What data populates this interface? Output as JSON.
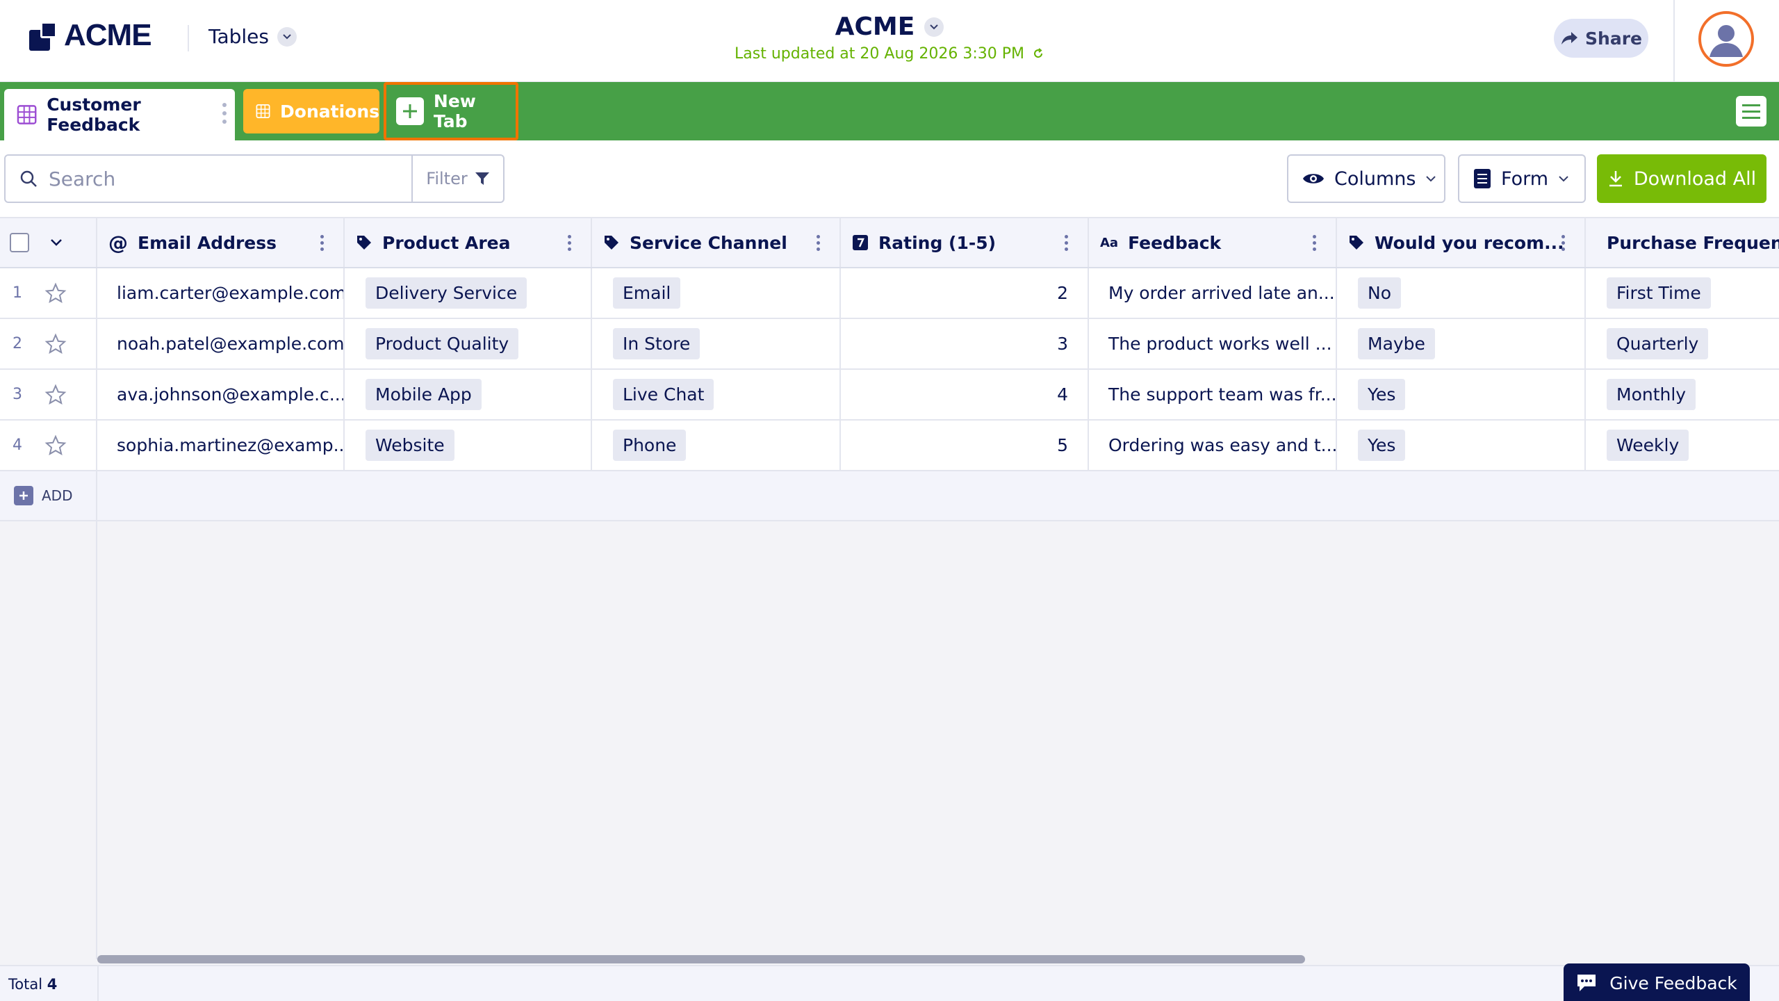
{
  "header": {
    "logo_text": "ACME",
    "tables_label": "Tables",
    "app_title": "ACME",
    "last_updated": "Last updated at 20 Aug 2026 3:30 PM",
    "share_label": "Share"
  },
  "tabs": [
    {
      "label": "Customer Feedback",
      "active": true
    },
    {
      "label": "Donations",
      "active": false
    },
    {
      "label": "New Tab",
      "active": false,
      "highlighted": true
    }
  ],
  "toolbar": {
    "search_placeholder": "Search",
    "filter_label": "Filter",
    "columns_label": "Columns",
    "form_label": "Form",
    "download_label": "Download All"
  },
  "table": {
    "columns": [
      {
        "label": "Email Address",
        "icon": "at-icon"
      },
      {
        "label": "Product Area",
        "icon": "tag-icon"
      },
      {
        "label": "Service Channel",
        "icon": "tag-icon"
      },
      {
        "label": "Rating (1-5)",
        "icon": "number-icon"
      },
      {
        "label": "Feedback",
        "icon": "text-icon"
      },
      {
        "label": "Would you recom...",
        "icon": "tag-icon"
      },
      {
        "label": "Purchase Frequen...",
        "icon": "tag-icon"
      }
    ],
    "rows": [
      {
        "num": "1",
        "email": "liam.carter@example.com",
        "product_area": "Delivery Service",
        "channel": "Email",
        "rating": "2",
        "feedback": "My order arrived late an...",
        "recommend": "No",
        "frequency": "First Time"
      },
      {
        "num": "2",
        "email": "noah.patel@example.com",
        "product_area": "Product Quality",
        "channel": "In Store",
        "rating": "3",
        "feedback": "The product works well ...",
        "recommend": "Maybe",
        "frequency": "Quarterly"
      },
      {
        "num": "3",
        "email": "ava.johnson@example.c...",
        "product_area": "Mobile App",
        "channel": "Live Chat",
        "rating": "4",
        "feedback": "The support team was fr...",
        "recommend": "Yes",
        "frequency": "Monthly"
      },
      {
        "num": "4",
        "email": "sophia.martinez@examp...",
        "product_area": "Website",
        "channel": "Phone",
        "rating": "5",
        "feedback": "Ordering was easy and t...",
        "recommend": "Yes",
        "frequency": "Weekly"
      }
    ],
    "add_label": "ADD"
  },
  "footer": {
    "total_label": "Total",
    "total_count": "4",
    "give_feedback_label": "Give Feedback"
  },
  "colors": {
    "tabbar": "#47a047",
    "donations_tab": "#ffb629",
    "new_tab_outline": "#f07300",
    "download": "#78bb07",
    "navy": "#0a1551",
    "updated_text": "#64b200"
  }
}
